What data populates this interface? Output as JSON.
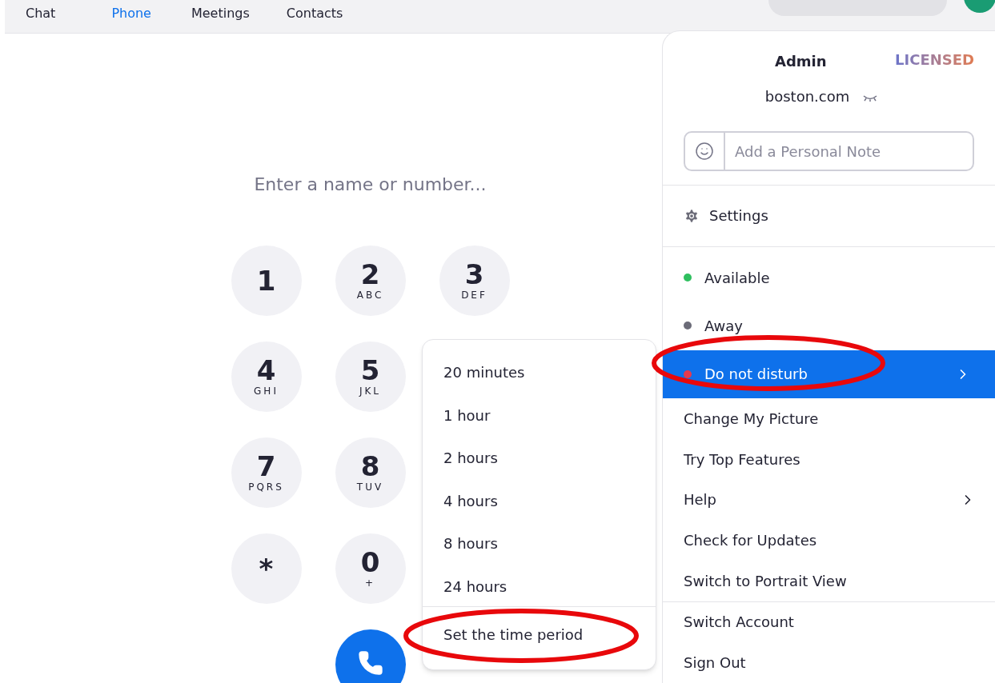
{
  "tabs": [
    {
      "label": "Chat",
      "selected": false
    },
    {
      "label": "Phone",
      "selected": true
    },
    {
      "label": "Meetings",
      "selected": false
    },
    {
      "label": "Contacts",
      "selected": false
    }
  ],
  "dialer": {
    "placeholder": "Enter a name or number...",
    "key_rows": [
      [
        {
          "digit": "1"
        },
        {
          "digit": "2",
          "letters": "ABC"
        },
        {
          "digit": "3",
          "letters": "DEF"
        }
      ],
      [
        {
          "digit": "4",
          "letters": "GHI"
        },
        {
          "digit": "5",
          "letters": "JKL"
        }
      ],
      [
        {
          "digit": "7",
          "letters": "PQRS"
        },
        {
          "digit": "8",
          "letters": "TUV"
        }
      ],
      [
        {
          "digit": "*"
        },
        {
          "digit": "0",
          "letters": "+"
        }
      ]
    ]
  },
  "profile_menu": {
    "name": "Admin",
    "license": "LICENSED",
    "domain": "boston.com",
    "note_field": {
      "placeholder": "Add a Personal Note"
    },
    "settings": {
      "label": "Settings"
    },
    "statuses": [
      {
        "label": "Available",
        "color": "#2fbf5f",
        "selected": false,
        "submenu": false
      },
      {
        "label": "Away",
        "color": "#6b6b78",
        "selected": false,
        "submenu": false
      },
      {
        "label": "Do not disturb",
        "color": "#e8394d",
        "selected": true,
        "submenu": true
      }
    ],
    "actions": [
      {
        "label": "Change My Picture",
        "submenu": false
      },
      {
        "label": "Try Top Features",
        "submenu": false
      },
      {
        "label": "Help",
        "submenu": true
      },
      {
        "label": "Check for Updates",
        "submenu": false
      },
      {
        "label": "Switch to Portrait View",
        "submenu": false
      }
    ],
    "account_actions": [
      {
        "label": "Switch Account"
      },
      {
        "label": "Sign Out"
      }
    ]
  },
  "dnd_submenu": {
    "durations": [
      "20 minutes",
      "1 hour",
      "2 hours",
      "4 hours",
      "8 hours",
      "24 hours"
    ],
    "custom": "Set the time period"
  }
}
